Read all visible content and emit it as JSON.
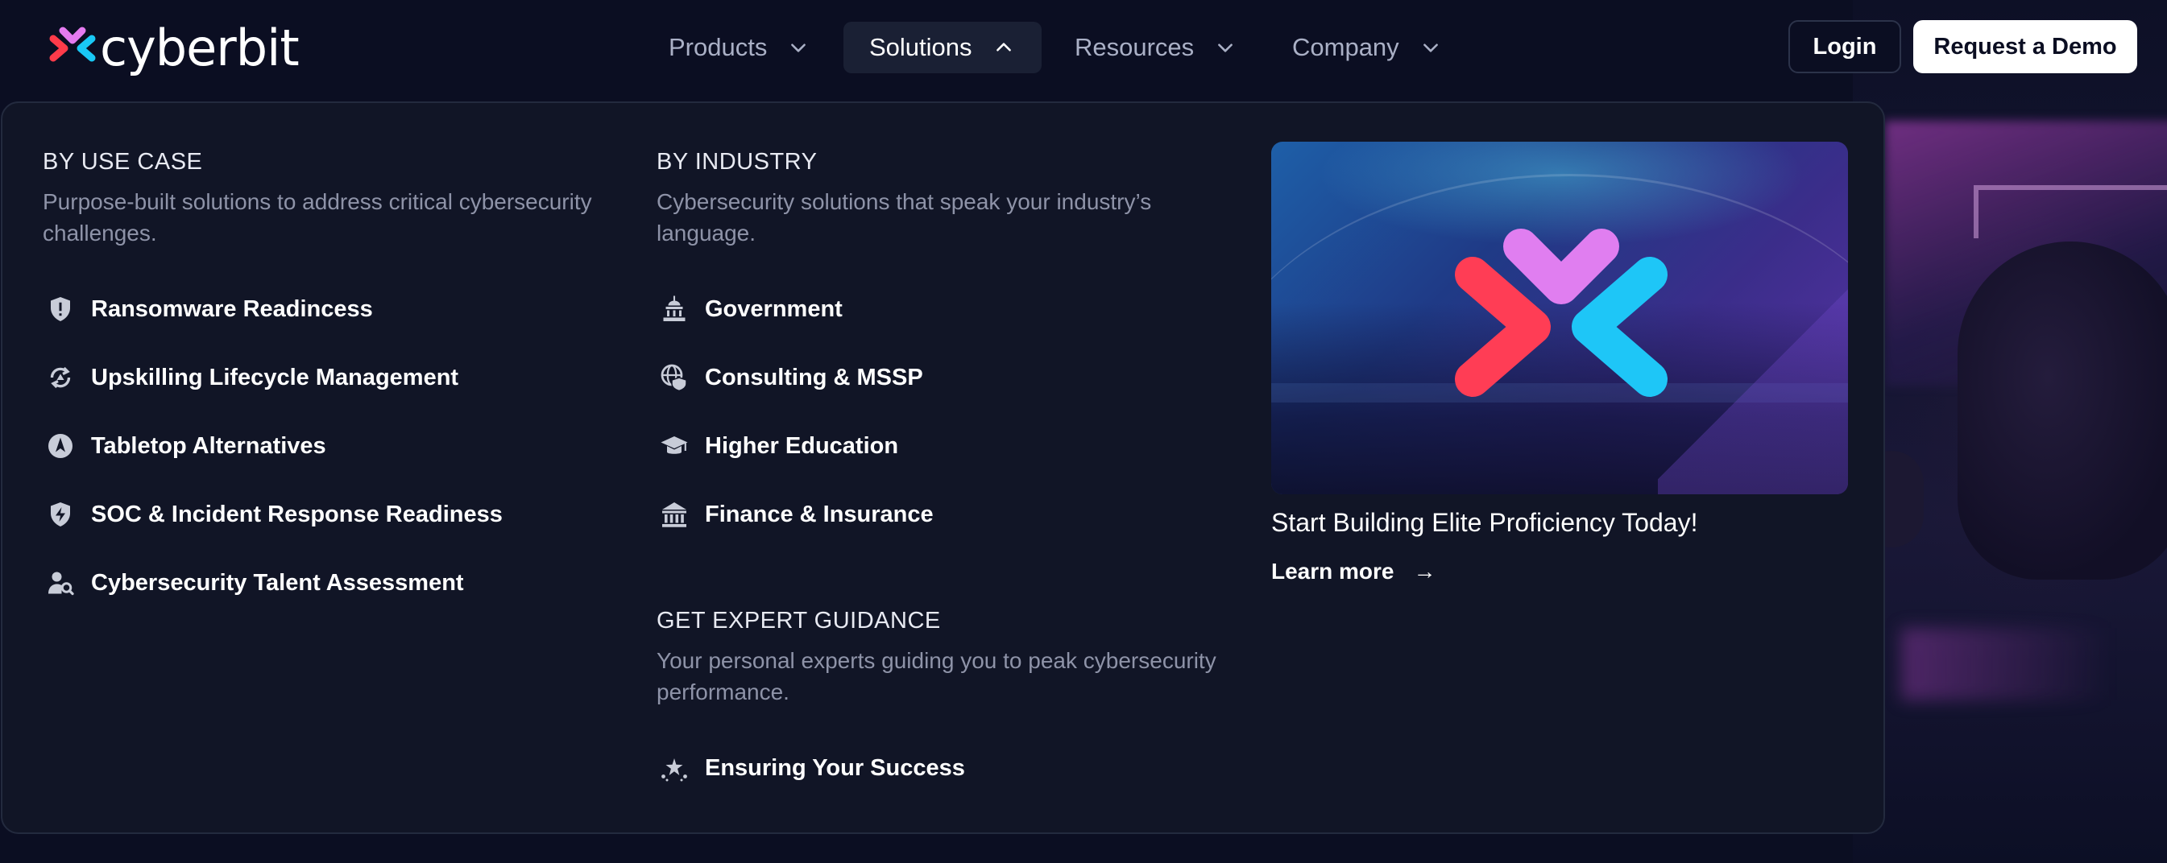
{
  "brand": {
    "name": "cyberbit"
  },
  "nav": {
    "items": [
      {
        "label": "Products",
        "icon": "chevron-down-icon"
      },
      {
        "label": "Solutions",
        "icon": "chevron-up-icon",
        "active": true
      },
      {
        "label": "Resources",
        "icon": "chevron-down-icon"
      },
      {
        "label": "Company",
        "icon": "chevron-down-icon"
      }
    ],
    "login_label": "Login",
    "demo_label": "Request a Demo"
  },
  "dropdown": {
    "use_case": {
      "title": "BY USE CASE",
      "description": "Purpose-built solutions to address critical cybersecurity challenges.",
      "items": [
        {
          "label": "Ransomware Readincess",
          "icon": "shield-alert-icon"
        },
        {
          "label": "Upskilling Lifecycle Management",
          "icon": "cycle-arrows-icon"
        },
        {
          "label": "Tabletop Alternatives",
          "icon": "compass-icon"
        },
        {
          "label": "SOC & Incident Response Readiness",
          "icon": "shield-bolt-icon"
        },
        {
          "label": "Cybersecurity Talent Assessment",
          "icon": "user-search-icon"
        }
      ]
    },
    "industry": {
      "title": "BY INDUSTRY",
      "description": "Cybersecurity solutions that speak your industry’s language.",
      "items": [
        {
          "label": "Government",
          "icon": "capitol-icon"
        },
        {
          "label": "Consulting & MSSP",
          "icon": "globe-shield-icon"
        },
        {
          "label": "Higher Education",
          "icon": "graduation-cap-icon"
        },
        {
          "label": "Finance & Insurance",
          "icon": "bank-icon"
        }
      ]
    },
    "guidance": {
      "title": "GET EXPERT GUIDANCE",
      "description": "Your personal experts guiding you to peak cybersecurity performance.",
      "items": [
        {
          "label": "Ensuring Your Success",
          "icon": "sparkle-stars-icon"
        }
      ]
    },
    "promo": {
      "title": "Start Building Elite Proficiency Today!",
      "link_label": "Learn more",
      "link_icon": "arrow-right-icon"
    }
  },
  "colors": {
    "background": "#0b0e22",
    "panel": "#111526",
    "logo_red": "#ff3b4a",
    "logo_pink": "#e57bf0",
    "logo_cyan": "#19c8f5"
  }
}
